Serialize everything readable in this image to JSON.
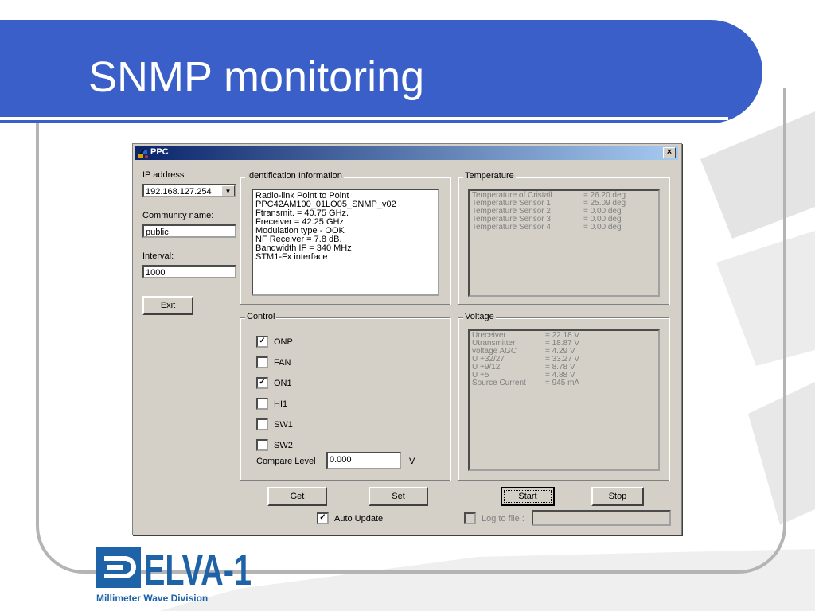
{
  "slide": {
    "title": "SNMP monitoring",
    "logo_text": "ELVA-1",
    "logo_subtitle": "Millimeter Wave Division",
    "accent": "#3a5fc8"
  },
  "window": {
    "title": "PPC",
    "close_glyph": "×",
    "icon": "app-icon"
  },
  "left_panel": {
    "ip_label": "IP address:",
    "ip_value": "192.168.127.254",
    "community_label": "Community name:",
    "community_value": "public",
    "interval_label": "Interval:",
    "interval_value": "1000",
    "exit_label": "Exit"
  },
  "identification": {
    "title": "Identification Information",
    "lines": [
      "Radio-link Point to Point",
      "PPC42AM100_01LO05_SNMP_v02",
      "Ftransmit.     = 40.75 GHz.",
      "Freceiver      = 42.25 GHz.",
      "Modulation type - OOK",
      "NF Receiver     = 7.8 dB.",
      "Bandwidth IF    = 340 MHz",
      "STM1-Fx interface"
    ]
  },
  "temperature": {
    "title": "Temperature",
    "rows": [
      {
        "name": "Temperature of Cristall",
        "value": "= 26.20 deg"
      },
      {
        "name": "Temperature Sensor 1",
        "value": "= 25.09 deg"
      },
      {
        "name": "Temperature Sensor 2",
        "value": "= 0.00 deg"
      },
      {
        "name": "Temperature Sensor 3",
        "value": "= 0.00 deg"
      },
      {
        "name": "Temperature Sensor 4",
        "value": "= 0.00 deg"
      }
    ]
  },
  "control": {
    "title": "Control",
    "checks": [
      {
        "label": "ONP",
        "checked": true,
        "mark": "✓"
      },
      {
        "label": "FAN",
        "checked": false,
        "mark": ""
      },
      {
        "label": "ON1",
        "checked": true,
        "mark": "✓"
      },
      {
        "label": "HI1",
        "checked": false,
        "mark": ""
      },
      {
        "label": "SW1",
        "checked": false,
        "mark": ""
      },
      {
        "label": "SW2",
        "checked": false,
        "mark": ""
      }
    ],
    "compare_label": "Compare Level",
    "compare_value": "0.000",
    "compare_unit": "V"
  },
  "voltage": {
    "title": "Voltage",
    "rows": [
      {
        "name": "Ureceiver",
        "value": "= 22.18 V"
      },
      {
        "name": "Utransmitter",
        "value": "= 18.87 V"
      },
      {
        "name": "voltage AGC",
        "value": "= 4.29 V"
      },
      {
        "name": "U +32/27",
        "value": "= 33.27 V"
      },
      {
        "name": "U +9/12",
        "value": "= 8.78 V"
      },
      {
        "name": "U +5",
        "value": "= 4.88 V"
      },
      {
        "name": "Source Current",
        "value": "= 945 mA"
      }
    ]
  },
  "bottom": {
    "get_label": "Get",
    "set_label": "Set",
    "start_label": "Start",
    "stop_label": "Stop",
    "auto_update_label": "Auto Update",
    "auto_update_mark": "✓",
    "log_label": "Log to file :",
    "log_value": ""
  }
}
